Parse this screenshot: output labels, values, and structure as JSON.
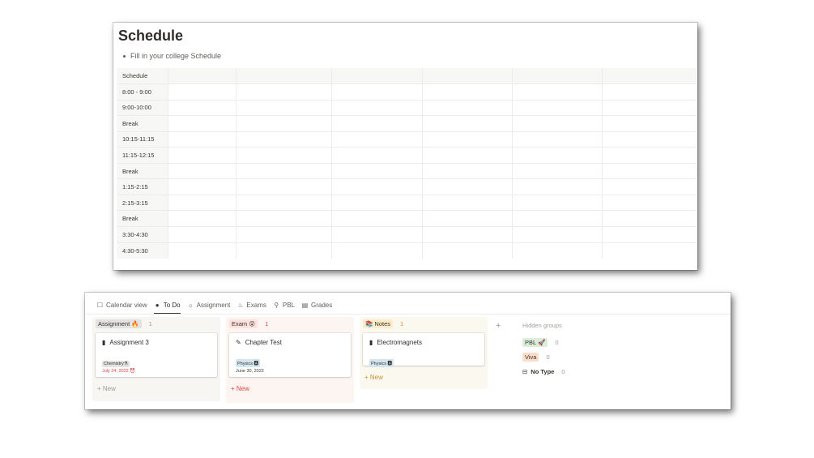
{
  "schedule": {
    "title": "Schedule",
    "bullet": "Fill in your college Schedule",
    "rows": [
      "Schedule",
      "8:00 - 9:00",
      "9:00-10:00",
      "Break",
      "10:15-11:15",
      "11:15-12:15",
      "Break",
      "1:15-2:15",
      "2:15-3:15",
      "Break",
      "3:30-4:30",
      "4:30-5:30"
    ]
  },
  "tabs": [
    {
      "icon": "calendar-icon",
      "glyph": "☐",
      "label": "Calendar view"
    },
    {
      "icon": "check-circle-icon",
      "glyph": "●",
      "label": "To Do"
    },
    {
      "icon": "sun-icon",
      "glyph": "☼",
      "label": "Assignment"
    },
    {
      "icon": "flame-icon",
      "glyph": "♨",
      "label": "Exams"
    },
    {
      "icon": "pin-icon",
      "glyph": "⚲",
      "label": "PBL"
    },
    {
      "icon": "book-icon",
      "glyph": "▤",
      "label": "Grades"
    }
  ],
  "columns": [
    {
      "label": "Assignment 🔥",
      "count": "1",
      "card": {
        "title": "Assignment 3",
        "tag": "Chemistry⚗",
        "date": "July 24, 2022 ⏰"
      },
      "new_label": "New"
    },
    {
      "label": "Exam 😲",
      "count": "1",
      "card": {
        "title": "Chapter Test",
        "tag": "Physics 🅰",
        "date": "June 30, 2022"
      },
      "new_label": "New"
    },
    {
      "label": "📚 Notes",
      "count": "1",
      "card": {
        "title": "Electromagnets",
        "tag": "Physics 🅰"
      },
      "new_label": "New"
    }
  ],
  "hidden_groups": {
    "label": "Hidden groups",
    "items": [
      {
        "label": "PBL 🚀",
        "count": "0"
      },
      {
        "label": "Viva",
        "count": "0"
      },
      {
        "label": "No Type",
        "count": "0"
      }
    ]
  },
  "colors": {
    "assignment_bg": "#f7f6f3",
    "assignment_chip": "#e3e2e0",
    "exam_bg": "#fdf5f2",
    "exam_chip": "#ffe2dd",
    "notes_bg": "#fbf8ef",
    "notes_chip": "#fdecc8",
    "red_text": "#e03e3e",
    "yellow_text": "#cb912f",
    "brown_text": "#9f6b53",
    "physics_tag": "#d3e5ef",
    "chemistry_tag": "#e3e2e0",
    "pbl_chip": "#dbeddb",
    "viva_chip": "#fadec9"
  }
}
